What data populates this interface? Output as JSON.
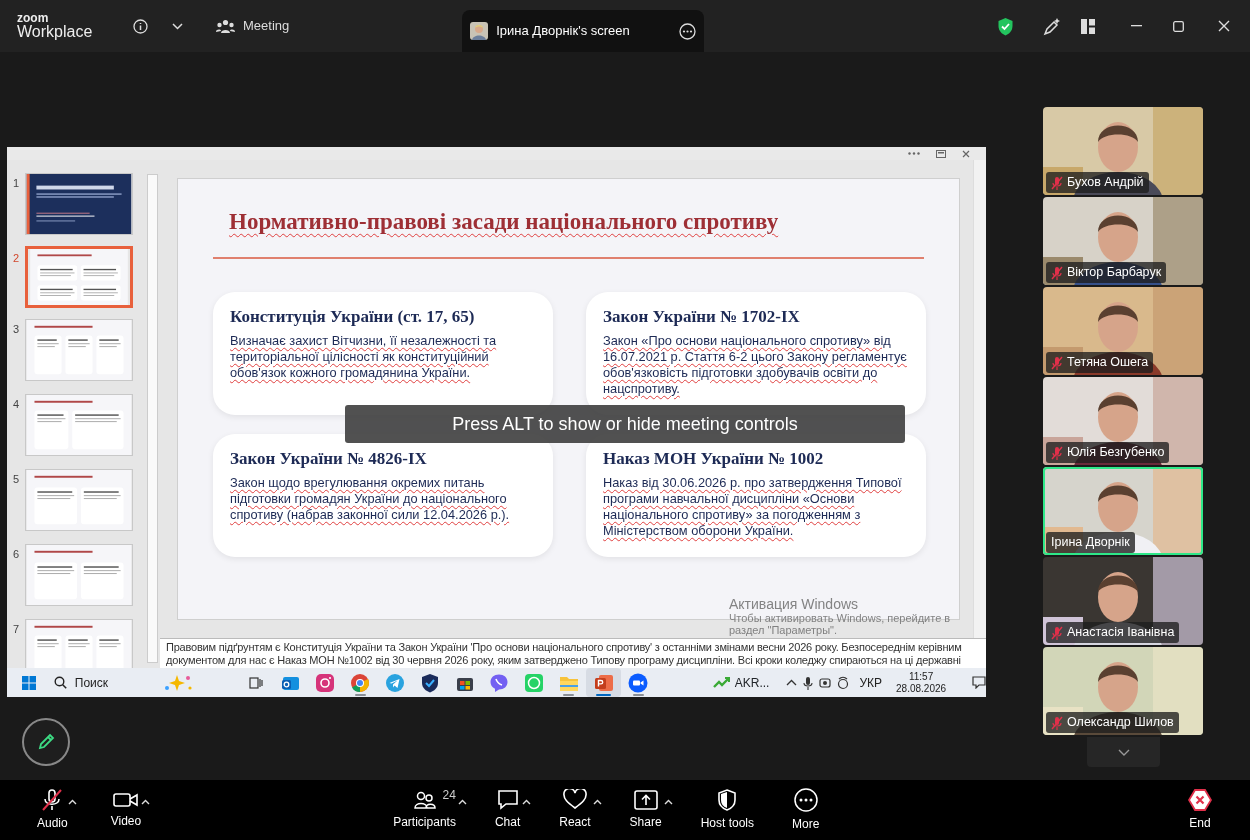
{
  "header": {
    "logo_top": "zoom",
    "logo_bottom": "Workplace",
    "meeting_label": "Meeting",
    "share_tab": "Ірина Дворнік's screen"
  },
  "presentation": {
    "slides": [
      {
        "number": "1",
        "selected": false,
        "kind": "title"
      },
      {
        "number": "2",
        "selected": true,
        "kind": "grid"
      },
      {
        "number": "3",
        "selected": false,
        "kind": "steps"
      },
      {
        "number": "4",
        "selected": false,
        "kind": "split"
      },
      {
        "number": "5",
        "selected": false,
        "kind": "two"
      },
      {
        "number": "6",
        "selected": false,
        "kind": "two"
      },
      {
        "number": "7",
        "selected": false,
        "kind": "steps"
      }
    ],
    "title": "Нормативно-правові засади національного спротиву",
    "cards": [
      {
        "title": "Конституція України (ст. 17, 65)",
        "body": "Визначає захист Вітчизни, її незалежності та територіальної цілісності як конституційний обов'язок кожного громадянина України."
      },
      {
        "title": "Закон України № 1702-IX",
        "body": "Закон «Про основи національного спротиву» від 16.07.2021 р. Стаття 6-2 цього Закону регламентує обов'язковість підготовки здобувачів освіти до нацспротиву."
      },
      {
        "title": "Закон України № 4826-IX",
        "body": "Закон щодо врегулювання окремих питань підготовки громадян України до національного спротиву (набрав законної сили 12.04.2026 р.)."
      },
      {
        "title": "Наказ МОН України № 1002",
        "body": "Наказ від 30.06.2026 р. про затвердження Типової програми навчальної дисципліни «Основи національного спротиву» за погодженням з Міністерством оборони України."
      }
    ],
    "notes": [
      "Правовим підґрунтям є Конституція України та Закон України 'Про основи національного спротиву' з останніми змінами весни 2026 року. Безпосереднім керівним",
      "документом для нас є Наказ МОН №1002 від 30 червня 2026 року, яким затверджено Типову програму дисципліни. Всі кроки коледжу спираються на ці державні"
    ]
  },
  "activation": {
    "title": "Активация Windows",
    "lines": [
      "Чтобы активировать Windows, перейдите в",
      "раздел \"Параметры\"."
    ]
  },
  "taskbar": {
    "search_placeholder": "Поиск",
    "apps": [
      {
        "kind": "outlook",
        "open": false,
        "selected": false
      },
      {
        "kind": "instagram",
        "open": false,
        "selected": false
      },
      {
        "kind": "chrome",
        "open": true,
        "selected": false
      },
      {
        "kind": "telegram",
        "open": false,
        "selected": false
      },
      {
        "kind": "shield",
        "open": false,
        "selected": false
      },
      {
        "kind": "store",
        "open": false,
        "selected": false
      },
      {
        "kind": "viber",
        "open": false,
        "selected": false
      },
      {
        "kind": "whatsapp",
        "open": false,
        "selected": false
      },
      {
        "kind": "explorer",
        "open": true,
        "selected": false
      },
      {
        "kind": "powerpoint",
        "open": true,
        "selected": true
      },
      {
        "kind": "zoom",
        "open": true,
        "selected": false
      }
    ],
    "stock": "AKR...",
    "language": "УКР",
    "time": "11:57",
    "date": "28.08.2026"
  },
  "overlay": {
    "message": "Press ALT to show or hide meeting controls"
  },
  "participants": [
    {
      "name": "Бухов Андрій",
      "muted": true,
      "speaking": false
    },
    {
      "name": "Віктор Барбарук",
      "muted": true,
      "speaking": false
    },
    {
      "name": "Тетяна Ошега",
      "muted": true,
      "speaking": false
    },
    {
      "name": "Юлія Безгубенко",
      "muted": true,
      "speaking": false
    },
    {
      "name": "Ірина Дворнік",
      "muted": false,
      "speaking": true
    },
    {
      "name": "Анастасія Іванівна",
      "muted": true,
      "speaking": false
    },
    {
      "name": "Олександр Шилов",
      "muted": true,
      "speaking": false
    }
  ],
  "toolbar": {
    "left": [
      {
        "kind": "audio",
        "label": "Audio",
        "muted": true
      },
      {
        "kind": "video",
        "label": "Video",
        "muted": false
      }
    ],
    "center": [
      {
        "kind": "participants",
        "label": "Participants",
        "count": "24",
        "caret": true
      },
      {
        "kind": "chat",
        "label": "Chat",
        "caret": true
      },
      {
        "kind": "react",
        "label": "React",
        "caret": true
      },
      {
        "kind": "share",
        "label": "Share",
        "caret": true
      },
      {
        "kind": "host",
        "label": "Host tools",
        "caret": false
      },
      {
        "kind": "more",
        "label": "More",
        "caret": false
      }
    ],
    "end": "End"
  }
}
